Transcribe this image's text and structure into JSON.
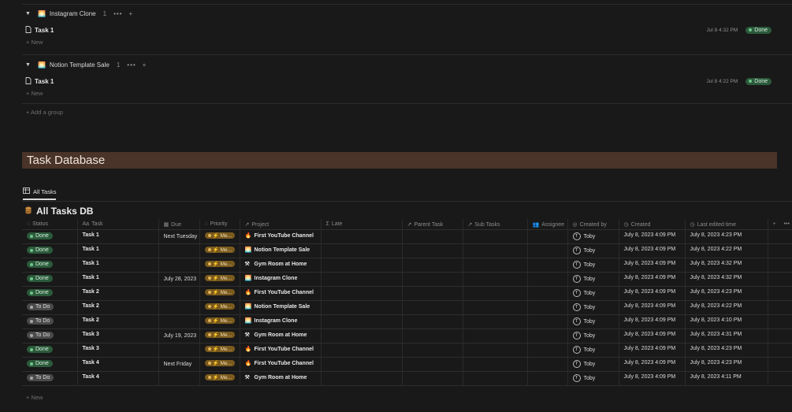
{
  "groups": [
    {
      "title": "Instagram Clone",
      "count": "1",
      "task": "Task 1",
      "date": "Jul 8 4:32 PM",
      "status": "Done",
      "new_label": "+ New"
    },
    {
      "title": "Notion Template Sale",
      "count": "1",
      "task": "Task 1",
      "date": "Jul 8 4:22 PM",
      "status": "Done",
      "new_label": "+ New"
    }
  ],
  "add_group_label": "+ Add a group",
  "banner_title": "Task Database",
  "view_tab": "All Tasks",
  "db_title": "All Tasks DB",
  "columns": [
    "Status",
    "Task",
    "Due",
    "Priority",
    "Project",
    "Late",
    "Parent Task",
    "Sub Tasks",
    "Assignee",
    "Created by",
    "Created",
    "Last edited time"
  ],
  "rows": [
    {
      "status": "Done",
      "task": "Task 1",
      "due": "Next Tuesday",
      "priority": "Me...",
      "project": "First YouTube Channel",
      "project_icon": "fire-icon",
      "created_by": "Toby",
      "created": "July 8, 2023 4:09 PM",
      "edited": "July 8, 2023 4:23 PM"
    },
    {
      "status": "Done",
      "task": "Task 1",
      "due": "",
      "priority": "Me...",
      "project": "Notion Template Sale",
      "project_icon": "sunset-icon",
      "created_by": "Toby",
      "created": "July 8, 2023 4:09 PM",
      "edited": "July 8, 2023 4:22 PM"
    },
    {
      "status": "Done",
      "task": "Task 1",
      "due": "",
      "priority": "Me...",
      "project": "Gym Room at Home",
      "project_icon": "tools-icon",
      "created_by": "Toby",
      "created": "July 8, 2023 4:09 PM",
      "edited": "July 8, 2023 4:32 PM"
    },
    {
      "status": "Done",
      "task": "Task 1",
      "due": "July 28, 2023",
      "priority": "Me...",
      "project": "Instagram Clone",
      "project_icon": "sunset-icon",
      "created_by": "Toby",
      "created": "July 8, 2023 4:09 PM",
      "edited": "July 8, 2023 4:32 PM"
    },
    {
      "status": "Done",
      "task": "Task 2",
      "due": "",
      "priority": "Me...",
      "project": "First YouTube Channel",
      "project_icon": "fire-icon",
      "created_by": "Toby",
      "created": "July 8, 2023 4:09 PM",
      "edited": "July 8, 2023 4:23 PM"
    },
    {
      "status": "To Do",
      "task": "Task 2",
      "due": "",
      "priority": "Me...",
      "project": "Notion Template Sale",
      "project_icon": "sunset-icon",
      "created_by": "Toby",
      "created": "July 8, 2023 4:09 PM",
      "edited": "July 8, 2023 4:22 PM"
    },
    {
      "status": "To Do",
      "task": "Task 2",
      "due": "",
      "priority": "Me...",
      "project": "Instagram Clone",
      "project_icon": "sunset-icon",
      "created_by": "Toby",
      "created": "July 8, 2023 4:09 PM",
      "edited": "July 8, 2023 4:10 PM"
    },
    {
      "status": "To Do",
      "task": "Task 3",
      "due": "July 19, 2023",
      "priority": "Me...",
      "project": "Gym Room at Home",
      "project_icon": "tools-icon",
      "created_by": "Toby",
      "created": "July 8, 2023 4:09 PM",
      "edited": "July 8, 2023 4:31 PM"
    },
    {
      "status": "Done",
      "task": "Task 3",
      "due": "",
      "priority": "Me...",
      "project": "First YouTube Channel",
      "project_icon": "fire-icon",
      "created_by": "Toby",
      "created": "July 8, 2023 4:09 PM",
      "edited": "July 8, 2023 4:23 PM"
    },
    {
      "status": "Done",
      "task": "Task 4",
      "due": "Next Friday",
      "priority": "Me...",
      "project": "First YouTube Channel",
      "project_icon": "fire-icon",
      "created_by": "Toby",
      "created": "July 8, 2023 4:09 PM",
      "edited": "July 8, 2023 4:23 PM"
    },
    {
      "status": "To Do",
      "task": "Task 4",
      "due": "",
      "priority": "Me...",
      "project": "Gym Room at Home",
      "project_icon": "tools-icon",
      "created_by": "Toby",
      "created": "July 8, 2023 4:09 PM",
      "edited": "July 8, 2023 4:11 PM"
    }
  ],
  "table_new_label": "+ New",
  "avatar_initial": "T",
  "colors": {
    "done_bg": "#2b5a3b",
    "todo_bg": "#4a4a4a",
    "priority_bg": "#7a5a1d",
    "banner_bg": "#4a3328"
  }
}
